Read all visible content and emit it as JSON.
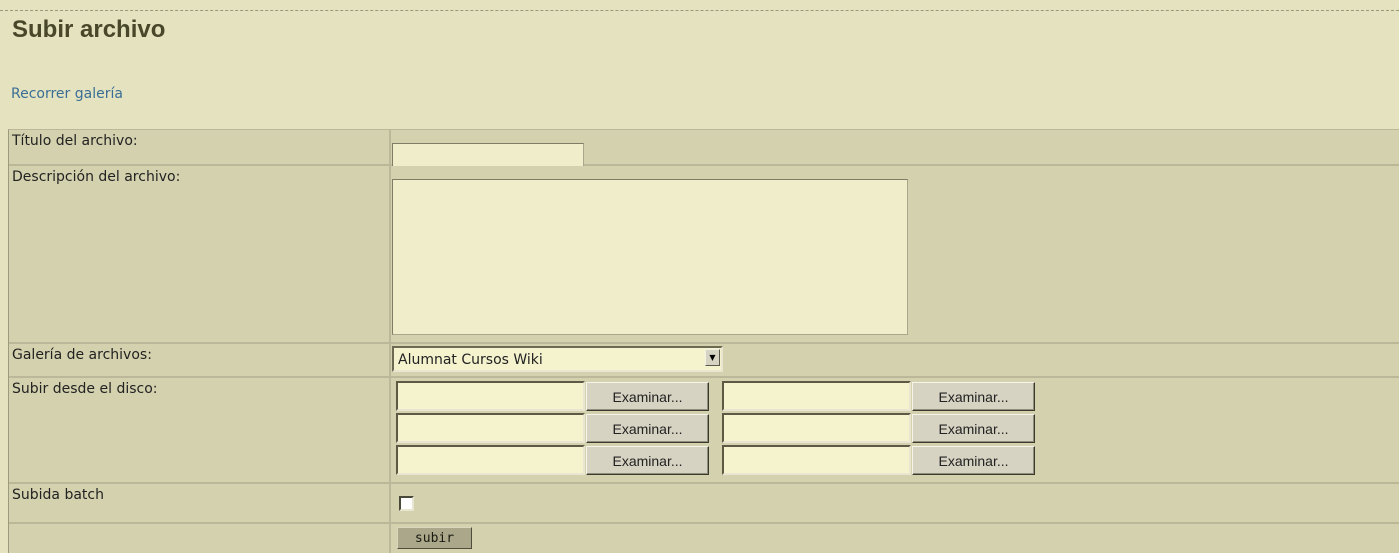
{
  "page": {
    "title": "Subir archivo",
    "gallery_link": "Recorrer galería"
  },
  "form": {
    "title_label": "Título del archivo:",
    "title_value": "",
    "description_label": "Descripción del archivo:",
    "description_value": "",
    "gallery_label": "Galería de archivos:",
    "gallery_selected": "Alumnat Cursos Wiki",
    "disk_label": "Subir desde el disco:",
    "browse_label": "Examinar...",
    "batch_label": "Subida batch",
    "batch_checked": false,
    "submit_label": "subir"
  },
  "icons": {
    "select_arrow": "chevron-down-icon"
  },
  "colors": {
    "page_bg": "#e4e2bf",
    "row_bg": "#d4d2ae",
    "input_bg": "#f0eeca",
    "title_color": "#48472a",
    "link_color": "#3a6e96"
  }
}
